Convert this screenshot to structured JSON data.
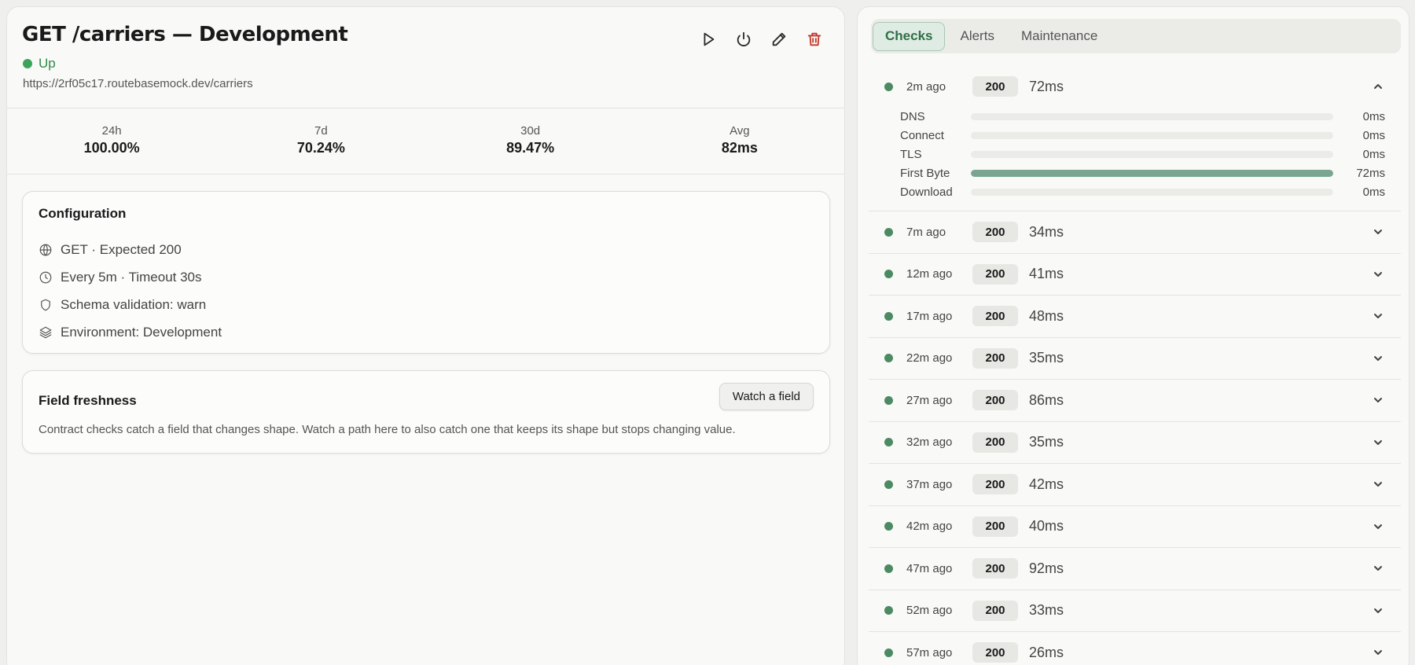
{
  "header": {
    "title": "GET /carriers — Development",
    "status": "Up",
    "url": "https://2rf05c17.routebasemock.dev/carriers"
  },
  "actions": {
    "run": "play-icon",
    "toggle": "power-icon",
    "edit": "pencil-icon",
    "delete": "trash-icon"
  },
  "stats": [
    {
      "label": "24h",
      "value": "100.00%"
    },
    {
      "label": "7d",
      "value": "70.24%"
    },
    {
      "label": "30d",
      "value": "89.47%"
    },
    {
      "label": "Avg",
      "value": "82ms"
    }
  ],
  "configuration": {
    "title": "Configuration",
    "items": [
      {
        "icon": "globe-icon",
        "text": "GET · Expected 200"
      },
      {
        "icon": "clock-icon",
        "text": "Every 5m · Timeout 30s"
      },
      {
        "icon": "shield-icon",
        "text": "Schema validation: warn"
      },
      {
        "icon": "layers-icon",
        "text": "Environment: Development"
      }
    ]
  },
  "freshness": {
    "title": "Field freshness",
    "button": "Watch a field",
    "description": "Contract checks catch a field that changes shape. Watch a path here to also catch one that keeps its shape but stops changing value."
  },
  "tabs": [
    {
      "label": "Checks",
      "active": true
    },
    {
      "label": "Alerts",
      "active": false
    },
    {
      "label": "Maintenance",
      "active": false
    }
  ],
  "checks": [
    {
      "time": "2m ago",
      "code": "200",
      "ms": "72ms",
      "expanded": true,
      "timing": [
        {
          "label": "DNS",
          "value": "0ms",
          "fraction": 0
        },
        {
          "label": "Connect",
          "value": "0ms",
          "fraction": 0
        },
        {
          "label": "TLS",
          "value": "0ms",
          "fraction": 0
        },
        {
          "label": "First Byte",
          "value": "72ms",
          "fraction": 1
        },
        {
          "label": "Download",
          "value": "0ms",
          "fraction": 0
        }
      ]
    },
    {
      "time": "7m ago",
      "code": "200",
      "ms": "34ms"
    },
    {
      "time": "12m ago",
      "code": "200",
      "ms": "41ms"
    },
    {
      "time": "17m ago",
      "code": "200",
      "ms": "48ms"
    },
    {
      "time": "22m ago",
      "code": "200",
      "ms": "35ms"
    },
    {
      "time": "27m ago",
      "code": "200",
      "ms": "86ms"
    },
    {
      "time": "32m ago",
      "code": "200",
      "ms": "35ms"
    },
    {
      "time": "37m ago",
      "code": "200",
      "ms": "42ms"
    },
    {
      "time": "42m ago",
      "code": "200",
      "ms": "40ms"
    },
    {
      "time": "47m ago",
      "code": "200",
      "ms": "92ms"
    },
    {
      "time": "52m ago",
      "code": "200",
      "ms": "33ms"
    },
    {
      "time": "57m ago",
      "code": "200",
      "ms": "26ms"
    }
  ],
  "colors": {
    "status_up": "#3aa55a",
    "check_dot": "#4c8a63",
    "timing_fill": "#7aa590",
    "danger": "#c0392b",
    "tab_active_bg": "#dfece3"
  }
}
